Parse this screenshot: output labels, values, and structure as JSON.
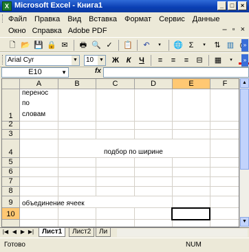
{
  "window": {
    "title": "Microsoft Excel - Книга1",
    "app_icon": "excel-icon"
  },
  "menu": {
    "items": [
      "Файл",
      "Правка",
      "Вид",
      "Вставка",
      "Формат",
      "Сервис",
      "Данные"
    ],
    "items_row2": [
      "Окно",
      "Справка",
      "Adobe PDF"
    ]
  },
  "format_toolbar": {
    "font": "Arial Cyr",
    "size": "10",
    "bold": "Ж",
    "italic": "К",
    "underline": "Ч"
  },
  "formula_bar": {
    "name_box": "E10",
    "fx": "fx",
    "formula": ""
  },
  "sheet": {
    "columns": [
      "A",
      "B",
      "C",
      "D",
      "E",
      "F"
    ],
    "rows": [
      "1",
      "2",
      "3",
      "4",
      "5",
      "6",
      "7",
      "8",
      "9",
      "10"
    ],
    "cells": {
      "A1_line1": "перенос",
      "A1_line2": "по",
      "A1_line3": "словам",
      "C4": "подбор по ширине",
      "A9": "объединение ячеек"
    },
    "active_cell": "E10"
  },
  "tabs": [
    "Лист1",
    "Лист2",
    "Ли"
  ],
  "status": {
    "left": "Готово",
    "num": "NUM"
  }
}
